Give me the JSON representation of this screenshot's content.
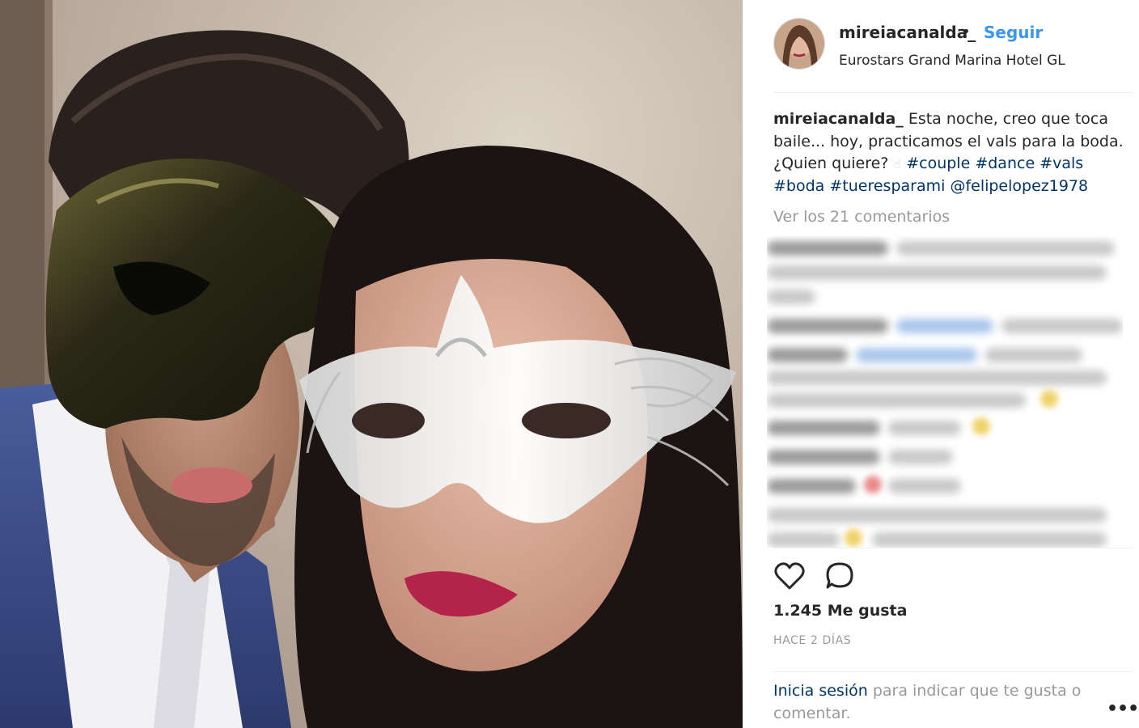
{
  "post": {
    "username": "mireiacanalda_",
    "separator": "•",
    "follow_label": "Seguir",
    "location": "Eurostars Grand Marina Hotel GL"
  },
  "caption": {
    "user": "mireiacanalda_",
    "text": "Esta noche, creo que toca baile... hoy, practicamos el vals para la boda. ¿Quien quiere?",
    "emoji": "☝",
    "tags": [
      "#couple",
      "#dance",
      "#vals",
      "#boda",
      "#tueresparami",
      "@felipelopez1978"
    ]
  },
  "view_comments": "Ver los 21 comentarios",
  "actions": {
    "like_icon": "heart-icon",
    "comment_icon": "comment-bubble-icon",
    "more_icon": "more-options-icon"
  },
  "likes_text": "1.245 Me gusta",
  "time_text": "HACE 2 DÍAS",
  "login_prompt": {
    "link": "Inicia sesión",
    "text": "para indicar que te gusta o comentar."
  },
  "colors": {
    "accent": "#3897f0",
    "link": "#003569",
    "muted": "#999999",
    "text": "#262626"
  }
}
